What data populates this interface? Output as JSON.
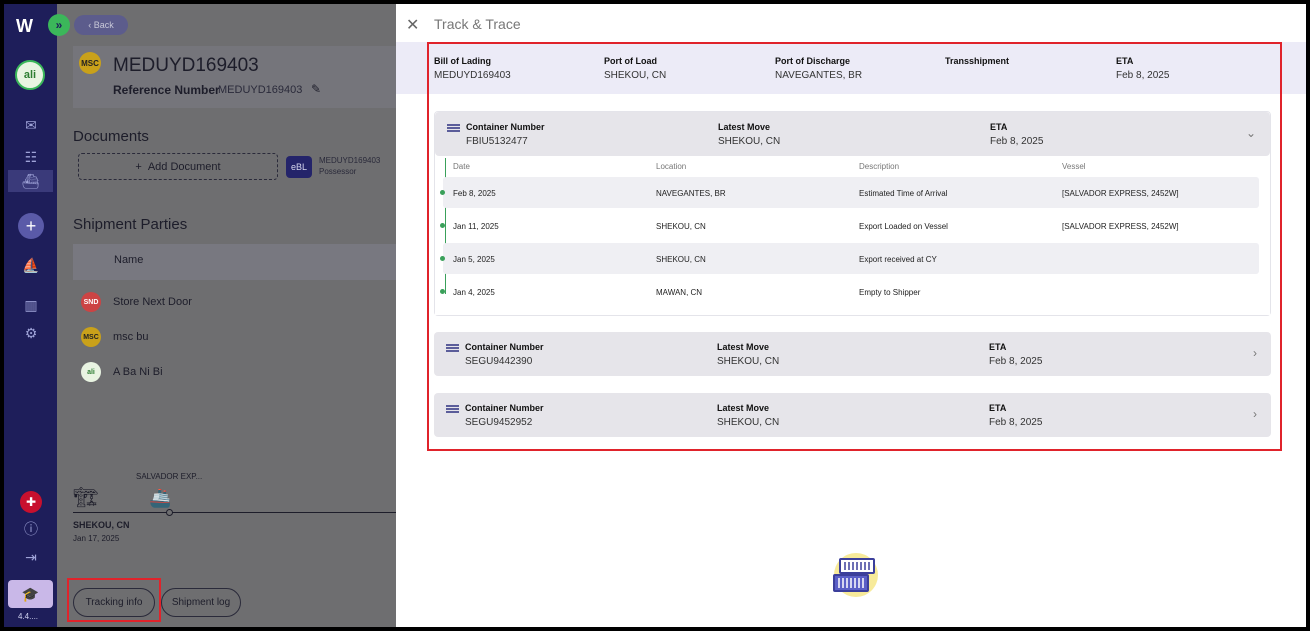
{
  "rail": {
    "logo": "W",
    "expand_glyph": "»",
    "org_avatar_text": "ali",
    "version": "4.4...."
  },
  "bg": {
    "back_label": "Back",
    "bl_number": "MEDUYD169403",
    "msc_logo_text": "MSC",
    "reference_label": "Reference Number",
    "reference_value": "MEDUYD169403",
    "documents_title": "Documents",
    "add_document_label": "Add Document",
    "ebl_badge": "eBL",
    "ebl_id": "MEDUYD169403",
    "ebl_role": "Possessor",
    "parties_title": "Shipment Parties",
    "name_col": "Name",
    "parties": [
      {
        "name": "Store Next Door",
        "avatar": "SND",
        "color": "#c44"
      },
      {
        "name": "msc bu",
        "avatar": "MSC",
        "color": "#c9a11a"
      },
      {
        "name": "A Ba Ni Bi",
        "avatar": "ali",
        "color": "#3bb75a"
      }
    ],
    "route_vessel": "SALVADOR EXP...",
    "route_port": "SHEKOU, CN",
    "route_date": "Jan 17, 2025",
    "tracking_info_label": "Tracking info",
    "shipment_log_label": "Shipment log"
  },
  "drawer": {
    "title": "Track & Trace",
    "summary": {
      "bol_label": "Bill of Lading",
      "bol_value": "MEDUYD169403",
      "pol_label": "Port of Load",
      "pol_value": "SHEKOU, CN",
      "pod_label": "Port of Discharge",
      "pod_value": "NAVEGANTES, BR",
      "trans_label": "Transshipment",
      "trans_value": "",
      "eta_label": "ETA",
      "eta_value": "Feb 8, 2025"
    },
    "containers": [
      {
        "num_label": "Container Number",
        "num": "FBIU5132477",
        "move_label": "Latest Move",
        "move": "SHEKOU, CN",
        "eta_label": "ETA",
        "eta": "Feb 8, 2025"
      },
      {
        "num_label": "Container Number",
        "num": "SEGU9442390",
        "move_label": "Latest Move",
        "move": "SHEKOU, CN",
        "eta_label": "ETA",
        "eta": "Feb 8, 2025"
      },
      {
        "num_label": "Container Number",
        "num": "SEGU9452952",
        "move_label": "Latest Move",
        "move": "SHEKOU, CN",
        "eta_label": "ETA",
        "eta": "Feb 8, 2025"
      }
    ],
    "events_header": {
      "date": "Date",
      "location": "Location",
      "description": "Description",
      "vessel": "Vessel"
    },
    "events": [
      {
        "date": "Feb 8, 2025",
        "location": "NAVEGANTES, BR",
        "description": "Estimated Time of Arrival",
        "vessel": "[SALVADOR EXPRESS, 2452W]"
      },
      {
        "date": "Jan 11, 2025",
        "location": "SHEKOU, CN",
        "description": "Export Loaded on Vessel",
        "vessel": "[SALVADOR EXPRESS, 2452W]"
      },
      {
        "date": "Jan 5, 2025",
        "location": "SHEKOU, CN",
        "description": "Export received at CY",
        "vessel": ""
      },
      {
        "date": "Jan 4, 2025",
        "location": "MAWAN, CN",
        "description": "Empty to Shipper",
        "vessel": ""
      }
    ]
  }
}
